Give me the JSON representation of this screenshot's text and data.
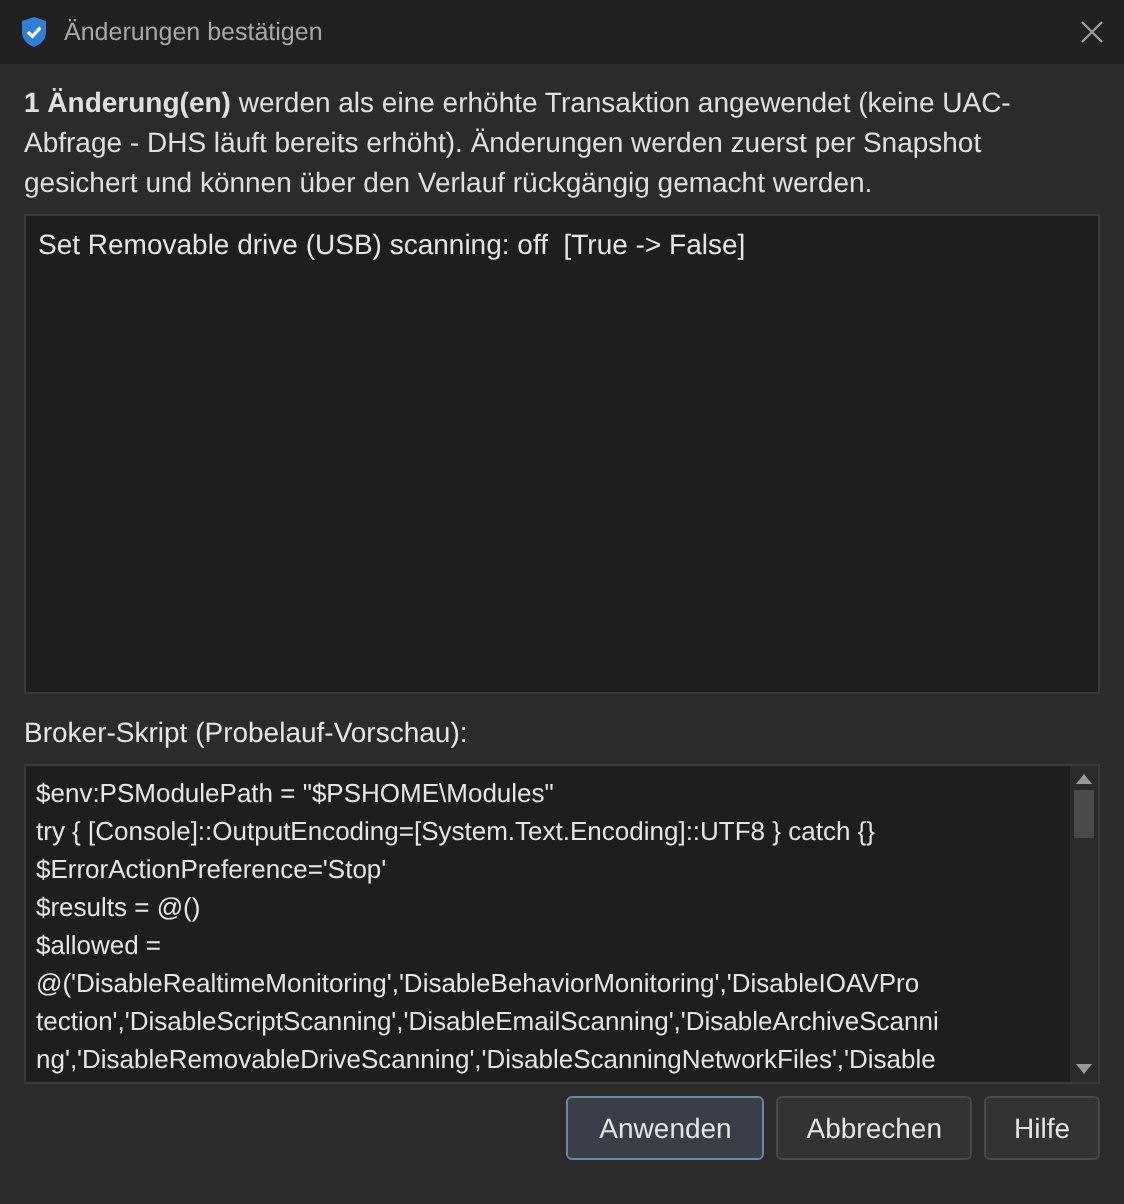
{
  "window": {
    "title": "Änderungen bestätigen"
  },
  "intro": "**1 Änderung(en)** werden als eine erhöhte Transaktion angewendet (keine UAC-Abfrage - DHS läuft bereits erhöht). Änderungen werden zuerst per Snapshot gesichert und können über den Verlauf rückgängig gemacht werden.",
  "changes": [
    "Set Removable drive (USB) scanning: off  [True -> False]"
  ],
  "script_label": "Broker-Skript (Probelauf-Vorschau):",
  "script_lines": [
    "$env:PSModulePath = \"$PSHOME\\Modules\"",
    "try { [Console]::OutputEncoding=[System.Text.Encoding]::UTF8 } catch {}",
    "$ErrorActionPreference='Stop'",
    "$results = @()",
    "$allowed =",
    "@('DisableRealtimeMonitoring','DisableBehaviorMonitoring','DisableIOAVPro",
    "tection','DisableScriptScanning','DisableEmailScanning','DisableArchiveScanni",
    "ng','DisableRemovableDriveScanning','DisableScanningNetworkFiles','Disable"
  ],
  "buttons": [
    {
      "label": "Anwenden",
      "kind": "default"
    },
    {
      "label": "Abbrechen",
      "kind": "normal"
    },
    {
      "label": "Hilfe",
      "kind": "normal"
    }
  ]
}
